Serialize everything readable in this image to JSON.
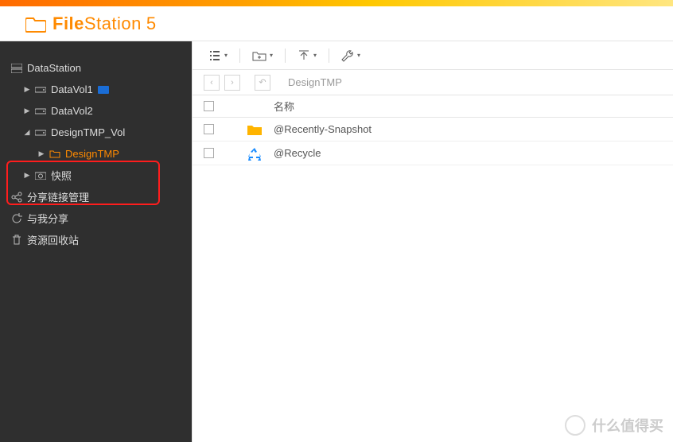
{
  "header": {
    "brand_bold": "File",
    "brand_light": "Station",
    "brand_num": "5"
  },
  "sidebar": {
    "root": "DataStation",
    "items": [
      {
        "label": "DataVol1",
        "badge": true
      },
      {
        "label": "DataVol2"
      },
      {
        "label": "DesignTMP_Vol",
        "expanded": true
      },
      {
        "label": "DesignTMP",
        "child": true,
        "active": true
      },
      {
        "label": "快照"
      }
    ],
    "extra": [
      {
        "label": "分享链接管理"
      },
      {
        "label": "与我分享"
      },
      {
        "label": "资源回收站"
      }
    ]
  },
  "breadcrumb": "DesignTMP",
  "columns": {
    "name": "名称"
  },
  "rows": [
    {
      "name": "@Recently-Snapshot",
      "icon": "folder"
    },
    {
      "name": "@Recycle",
      "icon": "recycle"
    }
  ],
  "watermark": "什么值得买"
}
